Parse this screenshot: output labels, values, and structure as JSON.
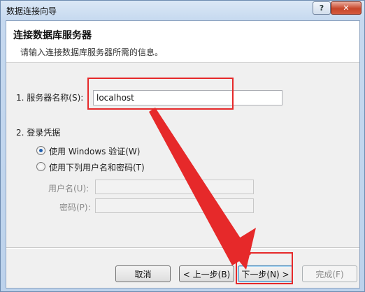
{
  "window": {
    "title": "数据连接向导",
    "help_label": "?",
    "close_label": "✕"
  },
  "header": {
    "title": "连接数据库服务器",
    "subtitle": "请输入连接数据库服务器所需的信息。"
  },
  "server": {
    "label": "1. 服务器名称(S):",
    "value": "localhost"
  },
  "credentials": {
    "section_label": "2. 登录凭据",
    "windows_auth_label": "使用 Windows 验证(W)",
    "windows_auth_selected": true,
    "user_pass_label": "使用下列用户名和密码(T)",
    "username_label": "用户名(U):",
    "username_value": "",
    "password_label": "密码(P):",
    "password_value": ""
  },
  "buttons": {
    "cancel": "取消",
    "back": "< 上一步(B)",
    "next": "下一步(N) >",
    "finish": "完成(F)"
  },
  "colors": {
    "annotation": "#e6292a",
    "radio_selected": "#1f5fb0"
  }
}
